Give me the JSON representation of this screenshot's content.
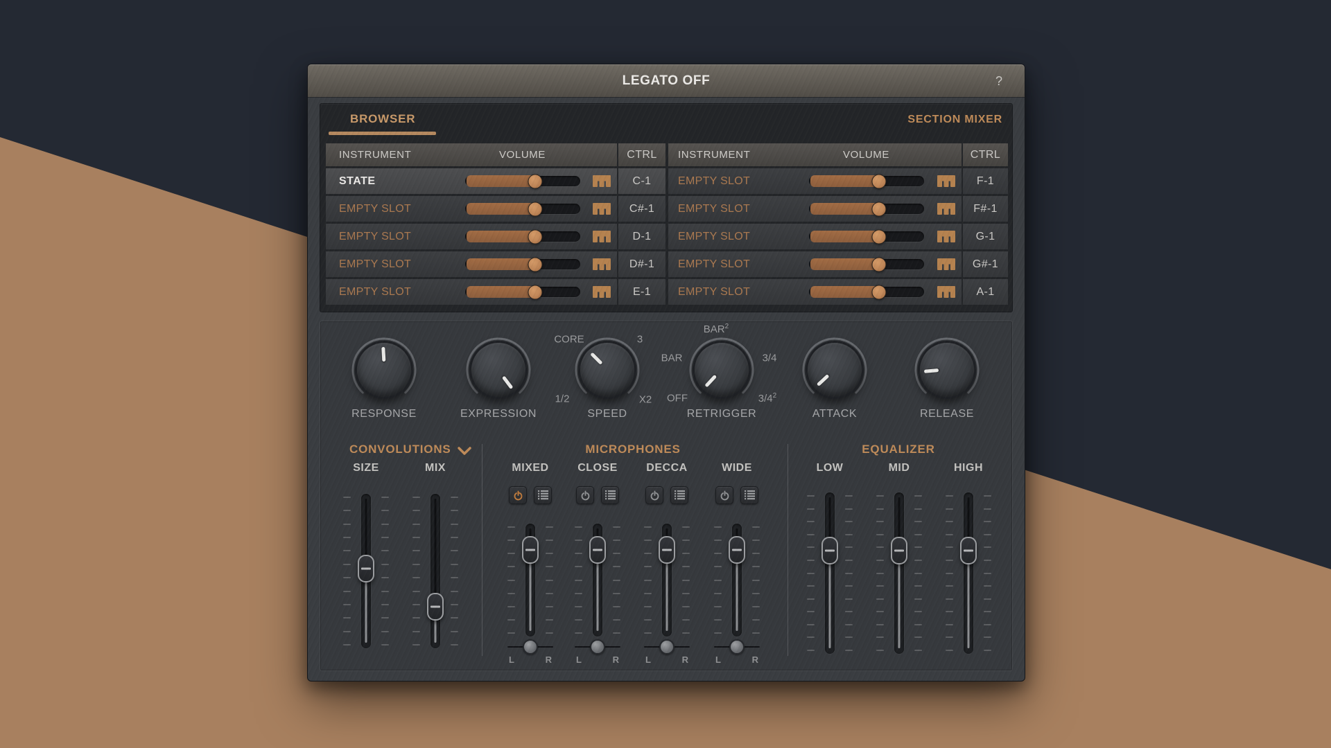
{
  "colors": {
    "background_dark": "#242933",
    "background_tan": "#a8805f",
    "accent": "#bf8b59",
    "accent_bright": "#c99a6a",
    "empty_slot_text": "#ab7950",
    "slider_fill": "#a26c44",
    "slider_thumb": "#c08758",
    "knob_pointer": "#e9e9e7",
    "power_active": "#c07c3e"
  },
  "window": {
    "title": "LEGATO OFF",
    "help_label": "?",
    "tabs": {
      "browser": "BROWSER",
      "section_mixer": "SECTION MIXER"
    },
    "table": {
      "headers": {
        "instrument": "INSTRUMENT",
        "volume": "VOLUME",
        "ctrl": "CTRL"
      },
      "left_rows": [
        {
          "instrument": "STATE",
          "ctrl": "C-1",
          "volume_pct": 61,
          "selected": true
        },
        {
          "instrument": "EMPTY SLOT",
          "ctrl": "C#-1",
          "volume_pct": 61,
          "selected": false
        },
        {
          "instrument": "EMPTY SLOT",
          "ctrl": "D-1",
          "volume_pct": 61,
          "selected": false
        },
        {
          "instrument": "EMPTY SLOT",
          "ctrl": "D#-1",
          "volume_pct": 61,
          "selected": false
        },
        {
          "instrument": "EMPTY SLOT",
          "ctrl": "E-1",
          "volume_pct": 61,
          "selected": false
        }
      ],
      "right_rows": [
        {
          "instrument": "EMPTY SLOT",
          "ctrl": "F-1",
          "volume_pct": 61,
          "selected": false
        },
        {
          "instrument": "EMPTY SLOT",
          "ctrl": "F#-1",
          "volume_pct": 61,
          "selected": false
        },
        {
          "instrument": "EMPTY SLOT",
          "ctrl": "G-1",
          "volume_pct": 61,
          "selected": false
        },
        {
          "instrument": "EMPTY SLOT",
          "ctrl": "G#-1",
          "volume_pct": 61,
          "selected": false
        },
        {
          "instrument": "EMPTY SLOT",
          "ctrl": "A-1",
          "volume_pct": 61,
          "selected": false
        }
      ]
    },
    "knobs": [
      {
        "label": "RESPONSE",
        "angle": -3,
        "options": []
      },
      {
        "label": "EXPRESSION",
        "angle": 143,
        "options": []
      },
      {
        "label": "SPEED",
        "angle": -45,
        "options": [
          {
            "text": "CORE"
          },
          {
            "text": "3"
          },
          {
            "text": "1/2"
          },
          {
            "text": "X2"
          }
        ]
      },
      {
        "label": "RETRIGGER",
        "angle": -137,
        "options": [
          {
            "text": "BAR",
            "sup": "2"
          },
          {
            "text": "BAR"
          },
          {
            "text": "3/4"
          },
          {
            "text": "OFF"
          },
          {
            "text": "3/4",
            "sup": "2"
          }
        ]
      },
      {
        "label": "ATTACK",
        "angle": -133,
        "options": []
      },
      {
        "label": "RELEASE",
        "angle": -95,
        "options": []
      }
    ],
    "convolutions": {
      "title": "CONVOLUTIONS",
      "faders": [
        {
          "label": "SIZE",
          "value_pct": 48
        },
        {
          "label": "MIX",
          "value_pct": 78
        }
      ]
    },
    "microphones": {
      "title": "MICROPHONES",
      "pan_left": "L",
      "pan_right": "R",
      "channels": [
        {
          "label": "MIXED",
          "power_on": true,
          "fader_pct": 15
        },
        {
          "label": "CLOSE",
          "power_on": false,
          "fader_pct": 15
        },
        {
          "label": "DECCA",
          "power_on": false,
          "fader_pct": 15
        },
        {
          "label": "WIDE",
          "power_on": false,
          "fader_pct": 15
        }
      ]
    },
    "equalizer": {
      "title": "EQUALIZER",
      "faders": [
        {
          "label": "LOW",
          "value_pct": 33
        },
        {
          "label": "MID",
          "value_pct": 33
        },
        {
          "label": "HIGH",
          "value_pct": 33
        }
      ]
    }
  }
}
